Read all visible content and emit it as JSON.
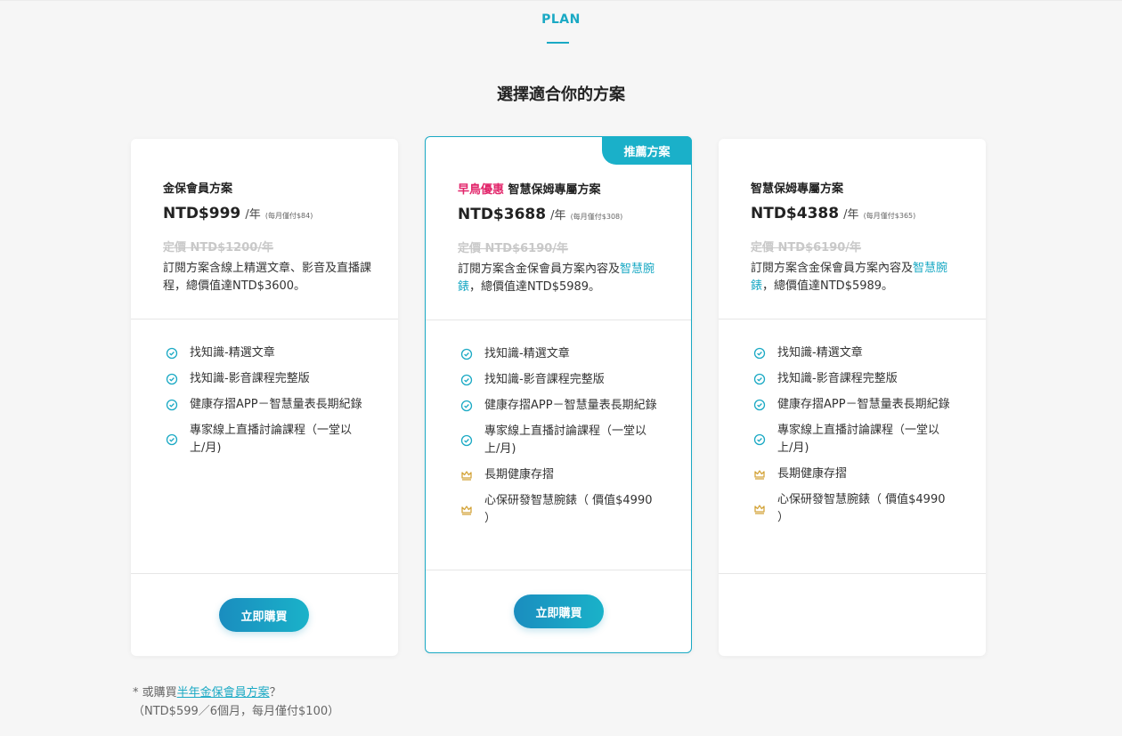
{
  "section": {
    "label": "PLAN",
    "heading": "選擇適合你的方案"
  },
  "colors": {
    "accent": "#1aa9c4",
    "promo": "#e2266b",
    "crown": "#d4a53c"
  },
  "plans": [
    {
      "name": "金保會員方案",
      "price": "NTD$999",
      "per": "/年",
      "monthly": "(每月僅付$84)",
      "original": "定價 NTD$1200/年",
      "desc": "訂閱方案含線上精選文章、影音及直播課程，總價值達NTD$3600。",
      "features": [
        {
          "icon": "check-circle-icon",
          "text": "找知識-精選文章"
        },
        {
          "icon": "check-circle-icon",
          "text": "找知識-影音課程完整版"
        },
        {
          "icon": "check-circle-icon",
          "text": "健康存摺APP－智慧量表長期紀錄"
        },
        {
          "icon": "check-circle-icon",
          "text": "專家線上直播討論課程（一堂以上/月)"
        }
      ],
      "buy_label": "立即購買"
    },
    {
      "ribbon": "推薦方案",
      "promo": "早鳥優惠",
      "name": "智慧保姆專屬方案",
      "price": "NTD$3688",
      "per": "/年",
      "monthly": "(每月僅付$308)",
      "original": "定價 NTD$6190/年",
      "desc_pre": "訂閱方案含金保會員方案內容及",
      "desc_hl": "智慧腕錶",
      "desc_post": "，總價值達NTD$5989。",
      "features": [
        {
          "icon": "check-circle-icon",
          "text": "找知識-精選文章"
        },
        {
          "icon": "check-circle-icon",
          "text": "找知識-影音課程完整版"
        },
        {
          "icon": "check-circle-icon",
          "text": "健康存摺APP－智慧量表長期紀錄"
        },
        {
          "icon": "check-circle-icon",
          "text": "專家線上直播討論課程（一堂以上/月)"
        },
        {
          "icon": "crown-icon",
          "text": "長期健康存摺"
        },
        {
          "icon": "crown-icon",
          "text": "心保研發智慧腕錶（ 價值$4990 ）"
        }
      ],
      "buy_label": "立即購買"
    },
    {
      "name": "智慧保姆專屬方案",
      "price": "NTD$4388",
      "per": "/年",
      "monthly": "(每月僅付$365)",
      "original": "定價 NTD$6190/年",
      "desc_pre": "訂閱方案含金保會員方案內容及",
      "desc_hl": "智慧腕錶",
      "desc_post": "，總價值達NTD$5989。",
      "features": [
        {
          "icon": "check-circle-icon",
          "text": "找知識-精選文章"
        },
        {
          "icon": "check-circle-icon",
          "text": "找知識-影音課程完整版"
        },
        {
          "icon": "check-circle-icon",
          "text": "健康存摺APP－智慧量表長期紀錄"
        },
        {
          "icon": "check-circle-icon",
          "text": "專家線上直播討論課程（一堂以上/月)"
        },
        {
          "icon": "crown-icon",
          "text": "長期健康存摺"
        },
        {
          "icon": "crown-icon",
          "text": "心保研發智慧腕錶（ 價值$4990 ）"
        }
      ]
    }
  ],
  "footnote": {
    "prefix": "* 或購買",
    "link": "半年金保會員方案",
    "suffix": "？",
    "line2": "（NTD$599／6個月，每月僅付$100）"
  }
}
